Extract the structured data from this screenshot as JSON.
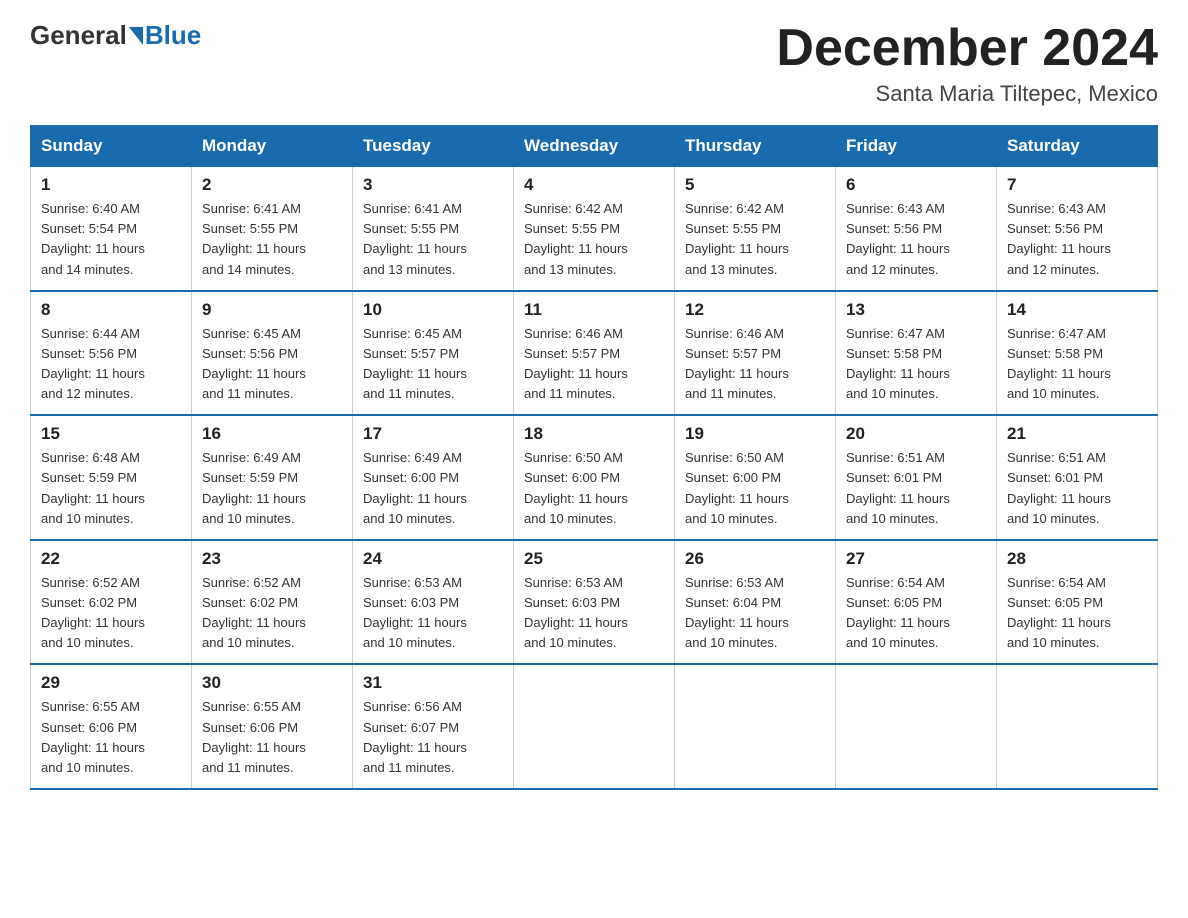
{
  "header": {
    "logo_general": "General",
    "logo_blue": "Blue",
    "month_title": "December 2024",
    "location": "Santa Maria Tiltepec, Mexico"
  },
  "days_of_week": [
    "Sunday",
    "Monday",
    "Tuesday",
    "Wednesday",
    "Thursday",
    "Friday",
    "Saturday"
  ],
  "weeks": [
    [
      {
        "day": "1",
        "sunrise": "6:40 AM",
        "sunset": "5:54 PM",
        "daylight": "11 hours and 14 minutes."
      },
      {
        "day": "2",
        "sunrise": "6:41 AM",
        "sunset": "5:55 PM",
        "daylight": "11 hours and 14 minutes."
      },
      {
        "day": "3",
        "sunrise": "6:41 AM",
        "sunset": "5:55 PM",
        "daylight": "11 hours and 13 minutes."
      },
      {
        "day": "4",
        "sunrise": "6:42 AM",
        "sunset": "5:55 PM",
        "daylight": "11 hours and 13 minutes."
      },
      {
        "day": "5",
        "sunrise": "6:42 AM",
        "sunset": "5:55 PM",
        "daylight": "11 hours and 13 minutes."
      },
      {
        "day": "6",
        "sunrise": "6:43 AM",
        "sunset": "5:56 PM",
        "daylight": "11 hours and 12 minutes."
      },
      {
        "day": "7",
        "sunrise": "6:43 AM",
        "sunset": "5:56 PM",
        "daylight": "11 hours and 12 minutes."
      }
    ],
    [
      {
        "day": "8",
        "sunrise": "6:44 AM",
        "sunset": "5:56 PM",
        "daylight": "11 hours and 12 minutes."
      },
      {
        "day": "9",
        "sunrise": "6:45 AM",
        "sunset": "5:56 PM",
        "daylight": "11 hours and 11 minutes."
      },
      {
        "day": "10",
        "sunrise": "6:45 AM",
        "sunset": "5:57 PM",
        "daylight": "11 hours and 11 minutes."
      },
      {
        "day": "11",
        "sunrise": "6:46 AM",
        "sunset": "5:57 PM",
        "daylight": "11 hours and 11 minutes."
      },
      {
        "day": "12",
        "sunrise": "6:46 AM",
        "sunset": "5:57 PM",
        "daylight": "11 hours and 11 minutes."
      },
      {
        "day": "13",
        "sunrise": "6:47 AM",
        "sunset": "5:58 PM",
        "daylight": "11 hours and 10 minutes."
      },
      {
        "day": "14",
        "sunrise": "6:47 AM",
        "sunset": "5:58 PM",
        "daylight": "11 hours and 10 minutes."
      }
    ],
    [
      {
        "day": "15",
        "sunrise": "6:48 AM",
        "sunset": "5:59 PM",
        "daylight": "11 hours and 10 minutes."
      },
      {
        "day": "16",
        "sunrise": "6:49 AM",
        "sunset": "5:59 PM",
        "daylight": "11 hours and 10 minutes."
      },
      {
        "day": "17",
        "sunrise": "6:49 AM",
        "sunset": "6:00 PM",
        "daylight": "11 hours and 10 minutes."
      },
      {
        "day": "18",
        "sunrise": "6:50 AM",
        "sunset": "6:00 PM",
        "daylight": "11 hours and 10 minutes."
      },
      {
        "day": "19",
        "sunrise": "6:50 AM",
        "sunset": "6:00 PM",
        "daylight": "11 hours and 10 minutes."
      },
      {
        "day": "20",
        "sunrise": "6:51 AM",
        "sunset": "6:01 PM",
        "daylight": "11 hours and 10 minutes."
      },
      {
        "day": "21",
        "sunrise": "6:51 AM",
        "sunset": "6:01 PM",
        "daylight": "11 hours and 10 minutes."
      }
    ],
    [
      {
        "day": "22",
        "sunrise": "6:52 AM",
        "sunset": "6:02 PM",
        "daylight": "11 hours and 10 minutes."
      },
      {
        "day": "23",
        "sunrise": "6:52 AM",
        "sunset": "6:02 PM",
        "daylight": "11 hours and 10 minutes."
      },
      {
        "day": "24",
        "sunrise": "6:53 AM",
        "sunset": "6:03 PM",
        "daylight": "11 hours and 10 minutes."
      },
      {
        "day": "25",
        "sunrise": "6:53 AM",
        "sunset": "6:03 PM",
        "daylight": "11 hours and 10 minutes."
      },
      {
        "day": "26",
        "sunrise": "6:53 AM",
        "sunset": "6:04 PM",
        "daylight": "11 hours and 10 minutes."
      },
      {
        "day": "27",
        "sunrise": "6:54 AM",
        "sunset": "6:05 PM",
        "daylight": "11 hours and 10 minutes."
      },
      {
        "day": "28",
        "sunrise": "6:54 AM",
        "sunset": "6:05 PM",
        "daylight": "11 hours and 10 minutes."
      }
    ],
    [
      {
        "day": "29",
        "sunrise": "6:55 AM",
        "sunset": "6:06 PM",
        "daylight": "11 hours and 10 minutes."
      },
      {
        "day": "30",
        "sunrise": "6:55 AM",
        "sunset": "6:06 PM",
        "daylight": "11 hours and 11 minutes."
      },
      {
        "day": "31",
        "sunrise": "6:56 AM",
        "sunset": "6:07 PM",
        "daylight": "11 hours and 11 minutes."
      },
      null,
      null,
      null,
      null
    ]
  ],
  "labels": {
    "sunrise": "Sunrise:",
    "sunset": "Sunset:",
    "daylight": "Daylight:"
  }
}
